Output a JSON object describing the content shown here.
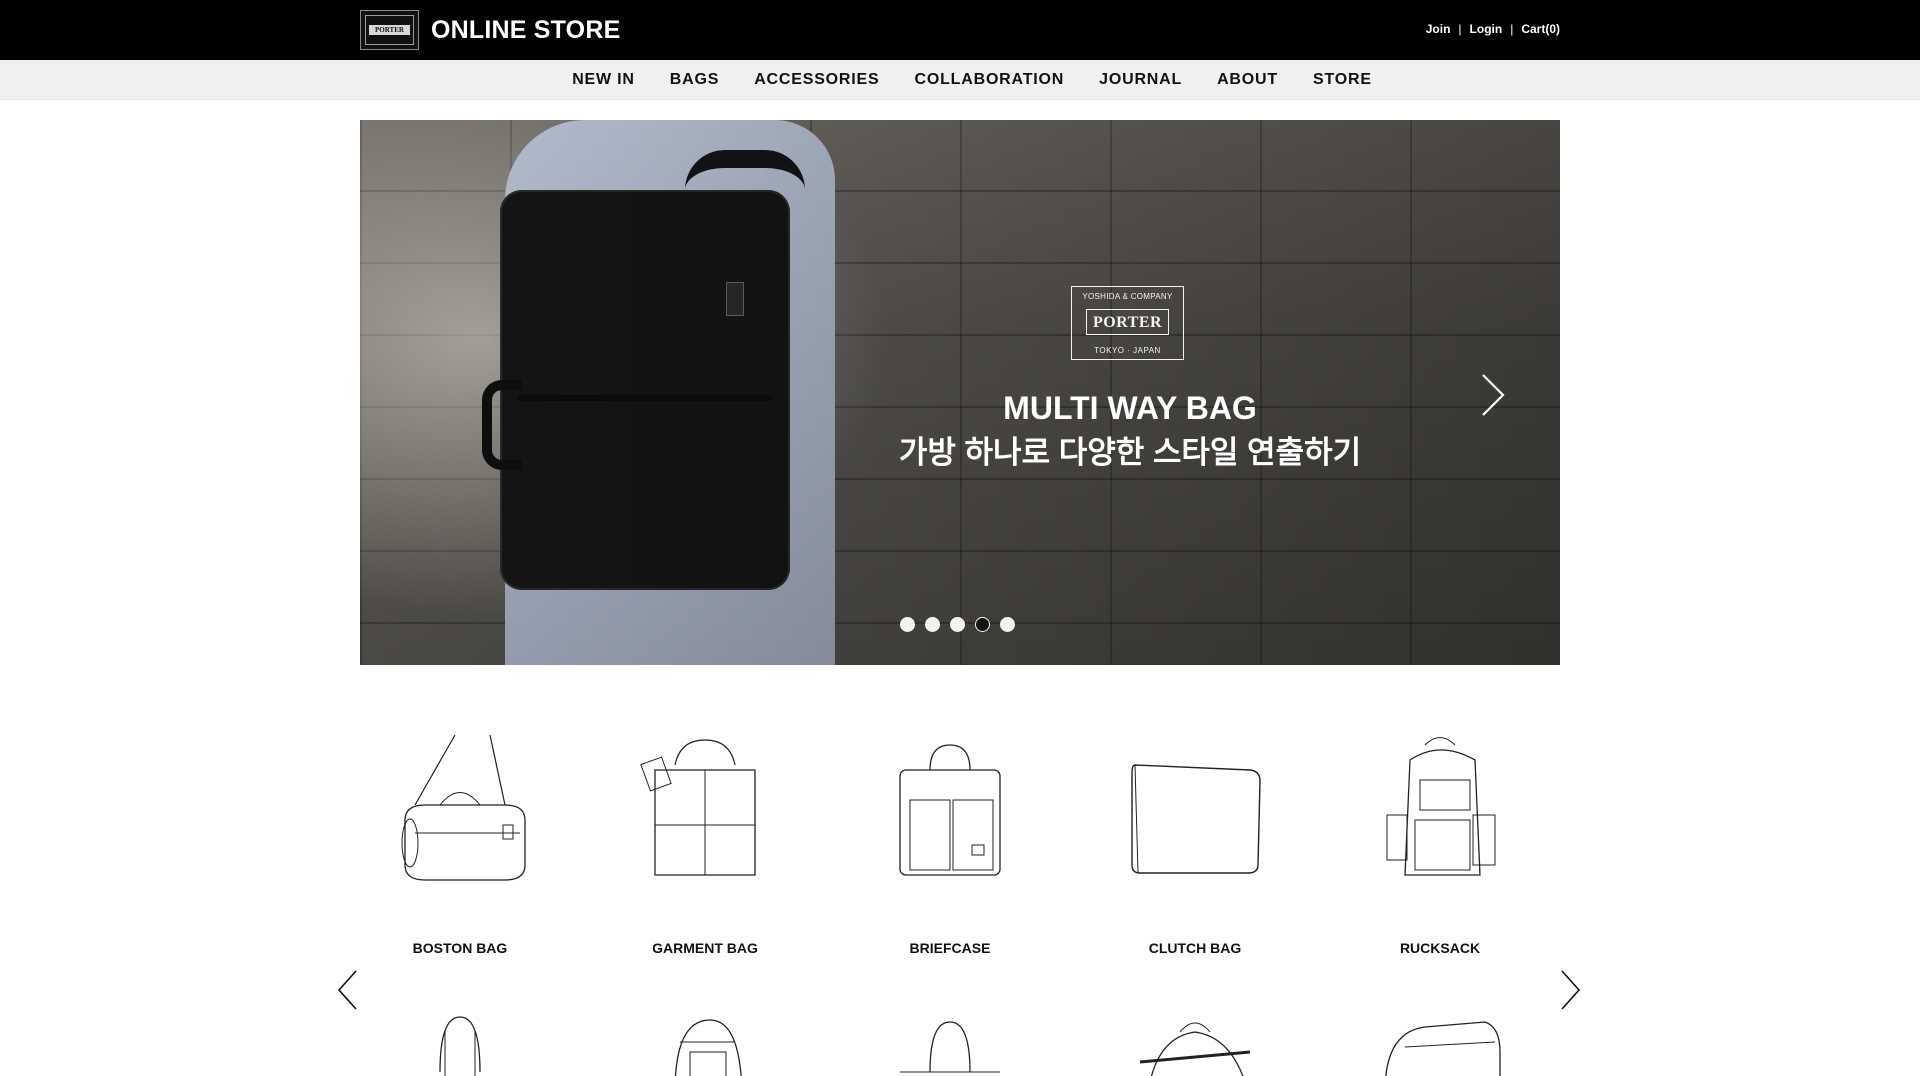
{
  "header": {
    "brand_logo_text": "PORTER",
    "title": "ONLINE STORE",
    "links": [
      {
        "label": "Join"
      },
      {
        "label": "Login"
      },
      {
        "label": "Cart(0)"
      }
    ],
    "separator": "|"
  },
  "nav": {
    "items": [
      {
        "label": "NEW IN"
      },
      {
        "label": "BAGS"
      },
      {
        "label": "ACCESSORIES"
      },
      {
        "label": "COLLABORATION"
      },
      {
        "label": "JOURNAL"
      },
      {
        "label": "ABOUT"
      },
      {
        "label": "STORE"
      }
    ]
  },
  "hero": {
    "logo": {
      "top_text": "YOSHIDA & COMPANY",
      "name": "PORTER",
      "bottom_text": "TOKYO · JAPAN"
    },
    "title": "MULTI WAY BAG",
    "subtitle": "가방 하나로 다양한 스타일 연출하기",
    "slides_total": 5,
    "active_slide": 4
  },
  "categories": {
    "items": [
      {
        "label": "BOSTON BAG",
        "icon": "boston-bag-icon"
      },
      {
        "label": "GARMENT BAG",
        "icon": "garment-bag-icon"
      },
      {
        "label": "BRIEFCASE",
        "icon": "briefcase-icon"
      },
      {
        "label": "CLUTCH BAG",
        "icon": "clutch-bag-icon"
      },
      {
        "label": "RUCKSACK",
        "icon": "rucksack-icon"
      }
    ]
  },
  "colors": {
    "topbar": "#000000",
    "nav_bg": "#f0f0f0",
    "text": "#111111"
  }
}
